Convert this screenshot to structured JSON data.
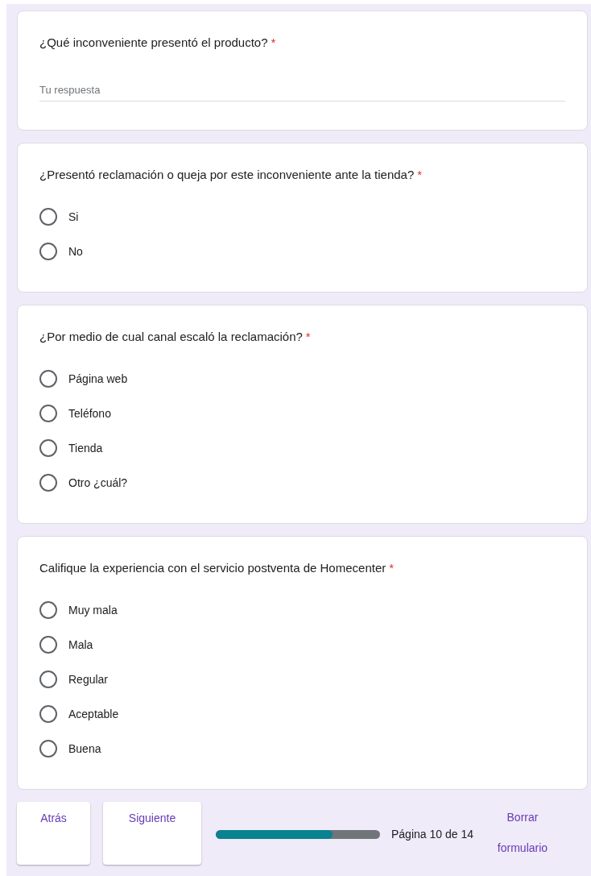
{
  "questions": [
    {
      "kind": "text",
      "title": "¿Qué inconveniente presentó el producto?",
      "required_mark": "*",
      "placeholder": "Tu respuesta"
    },
    {
      "kind": "radio",
      "title": "¿Presentó reclamación o queja por este inconveniente ante la tienda?",
      "required_mark": "*",
      "options": [
        {
          "label": "Si",
          "selected": false
        },
        {
          "label": "No",
          "selected": false
        }
      ]
    },
    {
      "kind": "radio",
      "title": "¿Por medio de cual canal escaló la reclamación?",
      "required_mark": "*",
      "options": [
        {
          "label": "Página web",
          "selected": false
        },
        {
          "label": "Teléfono",
          "selected": false
        },
        {
          "label": "Tienda",
          "selected": false
        },
        {
          "label": "Otro ¿cuál?",
          "selected": false
        }
      ]
    },
    {
      "kind": "radio",
      "title": "Califique la experiencia con el servicio postventa de Homecenter",
      "required_mark": "*",
      "options": [
        {
          "label": "Muy mala",
          "selected": false
        },
        {
          "label": "Mala",
          "selected": false
        },
        {
          "label": "Regular",
          "selected": false
        },
        {
          "label": "Aceptable",
          "selected": false
        },
        {
          "label": "Buena",
          "selected": false
        }
      ]
    }
  ],
  "footer": {
    "back": "Atrás",
    "next": "Siguiente",
    "progress": {
      "level": 0.71,
      "label": "Página 10 de 14"
    },
    "clear": "Borrar formulario"
  }
}
